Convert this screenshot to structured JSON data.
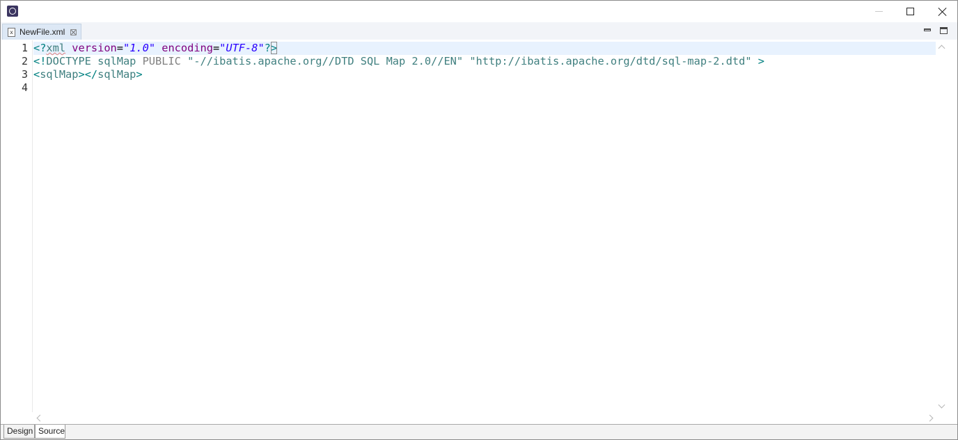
{
  "window": {
    "app_icon": "eclipse-icon",
    "controls": {
      "minimize": "minimize-icon",
      "maximize": "maximize-icon",
      "close": "close-icon"
    }
  },
  "editor_tab": {
    "icon": "xml-file-icon",
    "icon_glyph": "x",
    "label": "NewFile.xml",
    "close_icon": "close-tab-icon"
  },
  "view_controls": {
    "minimize": "view-minimize-icon",
    "maximize": "view-maximize-icon"
  },
  "gutter": {
    "line_numbers": [
      "1",
      "2",
      "3",
      "4"
    ]
  },
  "code": {
    "line1": {
      "open": "<?",
      "xml": "xml",
      "attr1": "version",
      "eq1": "=",
      "q1": "\"",
      "val1": "1.0",
      "q1b": "\"",
      "attr2": "encoding",
      "eq2": "=",
      "q2": "\"",
      "val2": "UTF-8",
      "q2b": "\"",
      "close_q": "?",
      "close": ">"
    },
    "line2": {
      "open": "<!",
      "doctype": "DOCTYPE",
      "name": "sqlMap",
      "public": "PUBLIC",
      "public_id": "\"-//ibatis.apache.org//DTD SQL Map 2.0//EN\"",
      "system_id": "\"http://ibatis.apache.org/dtd/sql-map-2.dtd\"",
      "close": ">"
    },
    "line3": {
      "open": "<",
      "tag": "sqlMap",
      "close": ">",
      "end_open": "</",
      "end_tag": "sqlMap",
      "end_close": ">"
    },
    "line4": ""
  },
  "page_tabs": [
    "Design",
    "Source"
  ],
  "selected_page_tab": "Source",
  "colors": {
    "current_line": "#e8f2fe",
    "tag_bracket": "#008080",
    "attribute_name": "#7f007f",
    "attribute_value": "#2a00ff",
    "doctype": "#3f7f7f"
  }
}
